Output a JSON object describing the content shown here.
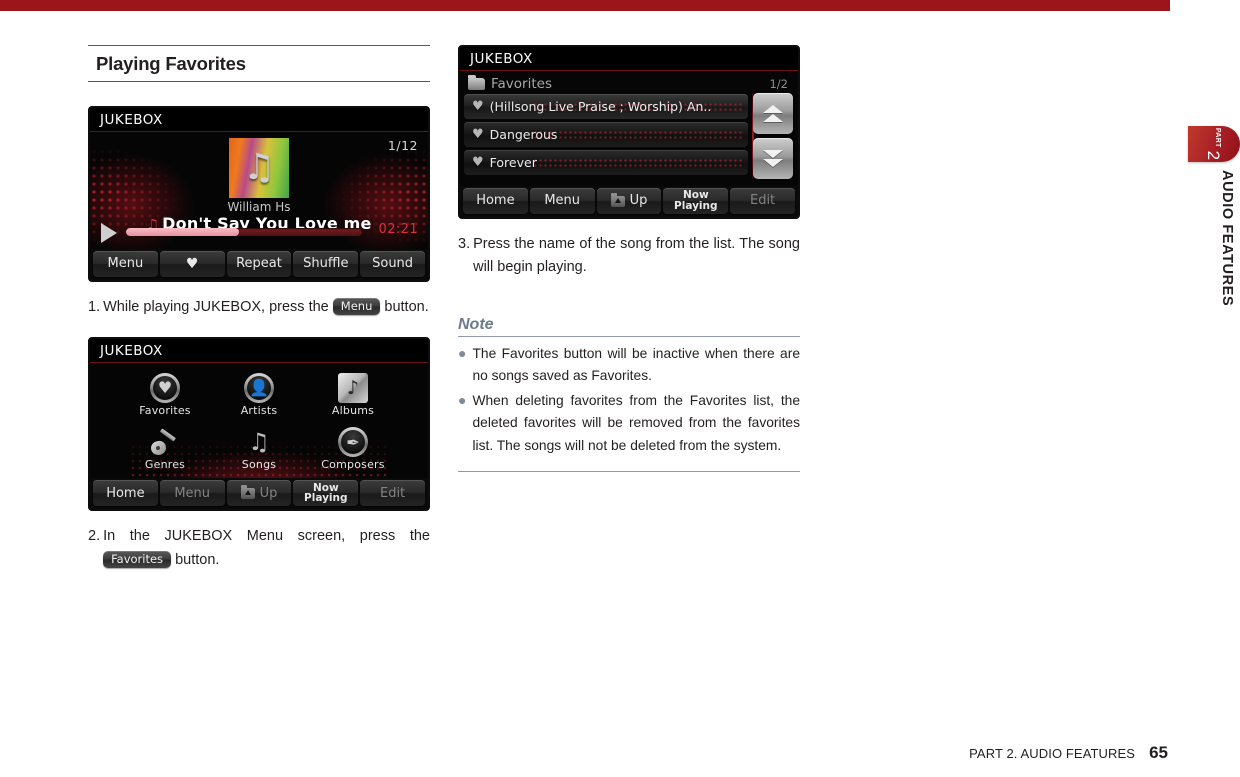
{
  "page": {
    "accent_red": "#9b151b",
    "footer_title": "PART 2. AUDIO FEATURES",
    "footer_page": "65"
  },
  "side_tab": {
    "part_word": "PART",
    "part_number": "2",
    "part_label": "AUDIO FEATURES"
  },
  "left_column": {
    "heading": "Playing Favorites",
    "now_playing_screen": {
      "title": "JUKEBOX",
      "track_count": "1/12",
      "album_art_icon": "music-note-icon",
      "artist": "William Hs",
      "song": "Don't Say You Love me",
      "song_note_icon": "double-music-note-icon",
      "play_icon": "play-triangle-icon",
      "time": "02:21",
      "progress_percent": 48,
      "toolbar": [
        {
          "label": "Menu",
          "icon": "",
          "dim": false
        },
        {
          "label": "",
          "icon": "heart-icon",
          "dim": false
        },
        {
          "label": "Repeat",
          "icon": "",
          "dim": false
        },
        {
          "label": "Shuffle",
          "icon": "",
          "dim": false
        },
        {
          "label": "Sound",
          "icon": "",
          "dim": false
        }
      ]
    },
    "step1": {
      "number": "1.",
      "text_before": "While playing JUKEBOX, press the",
      "chip": "Menu",
      "text_after": "button."
    },
    "menu_screen": {
      "title": "JUKEBOX",
      "items": [
        {
          "label": "Favorites",
          "icon": "heart-round-icon"
        },
        {
          "label": "Artists",
          "icon": "person-round-icon"
        },
        {
          "label": "Albums",
          "icon": "music-note-square-icon"
        },
        {
          "label": "Genres",
          "icon": "guitar-icon"
        },
        {
          "label": "Songs",
          "icon": "double-music-note-icon"
        },
        {
          "label": "Composers",
          "icon": "pen-nib-round-icon"
        }
      ],
      "toolbar": [
        {
          "label": "Home",
          "icon": "",
          "dim": false,
          "two_line": false
        },
        {
          "label": "Menu",
          "icon": "",
          "dim": true,
          "two_line": false
        },
        {
          "label": "Up",
          "icon": "folder-up-icon",
          "dim": true,
          "two_line": false
        },
        {
          "label": "Now\nPlaying",
          "icon": "",
          "dim": false,
          "two_line": true
        },
        {
          "label": "Edit",
          "icon": "",
          "dim": true,
          "two_line": false
        }
      ]
    },
    "step2": {
      "number": "2.",
      "text_before": "In the JUKEBOX Menu screen, press the",
      "chip": "Favorites",
      "text_after": "button."
    }
  },
  "right_column": {
    "list_screen": {
      "title": "JUKEBOX",
      "folder_icon": "folder-icon",
      "folder_label": "Favorites",
      "page_indicator": "1/2",
      "rows": [
        {
          "icon": "heart-icon",
          "label": "(Hillsong Live Praise ; Worship) An.."
        },
        {
          "icon": "heart-icon",
          "label": "Dangerous"
        },
        {
          "icon": "heart-icon",
          "label": "Forever"
        }
      ],
      "scroll_up_icon": "double-chevron-up-icon",
      "scroll_down_icon": "double-chevron-down-icon",
      "toolbar": [
        {
          "label": "Home",
          "icon": "",
          "dim": false,
          "two_line": false
        },
        {
          "label": "Menu",
          "icon": "",
          "dim": false,
          "two_line": false
        },
        {
          "label": "Up",
          "icon": "folder-up-icon",
          "dim": false,
          "two_line": false
        },
        {
          "label": "Now\nPlaying",
          "icon": "",
          "dim": false,
          "two_line": true
        },
        {
          "label": "Edit",
          "icon": "",
          "dim": true,
          "two_line": false
        }
      ]
    },
    "step3": {
      "number": "3.",
      "text": "Press the name of the song from the list. The song will begin playing."
    },
    "note": {
      "heading": "Note",
      "items": [
        "The Favorites button will be inactive when there are no songs saved as Favorites.",
        "When deleting favorites from the Favorites list, the deleted favorites will be removed from the favorites list. The songs will not be deleted from the system."
      ]
    }
  }
}
